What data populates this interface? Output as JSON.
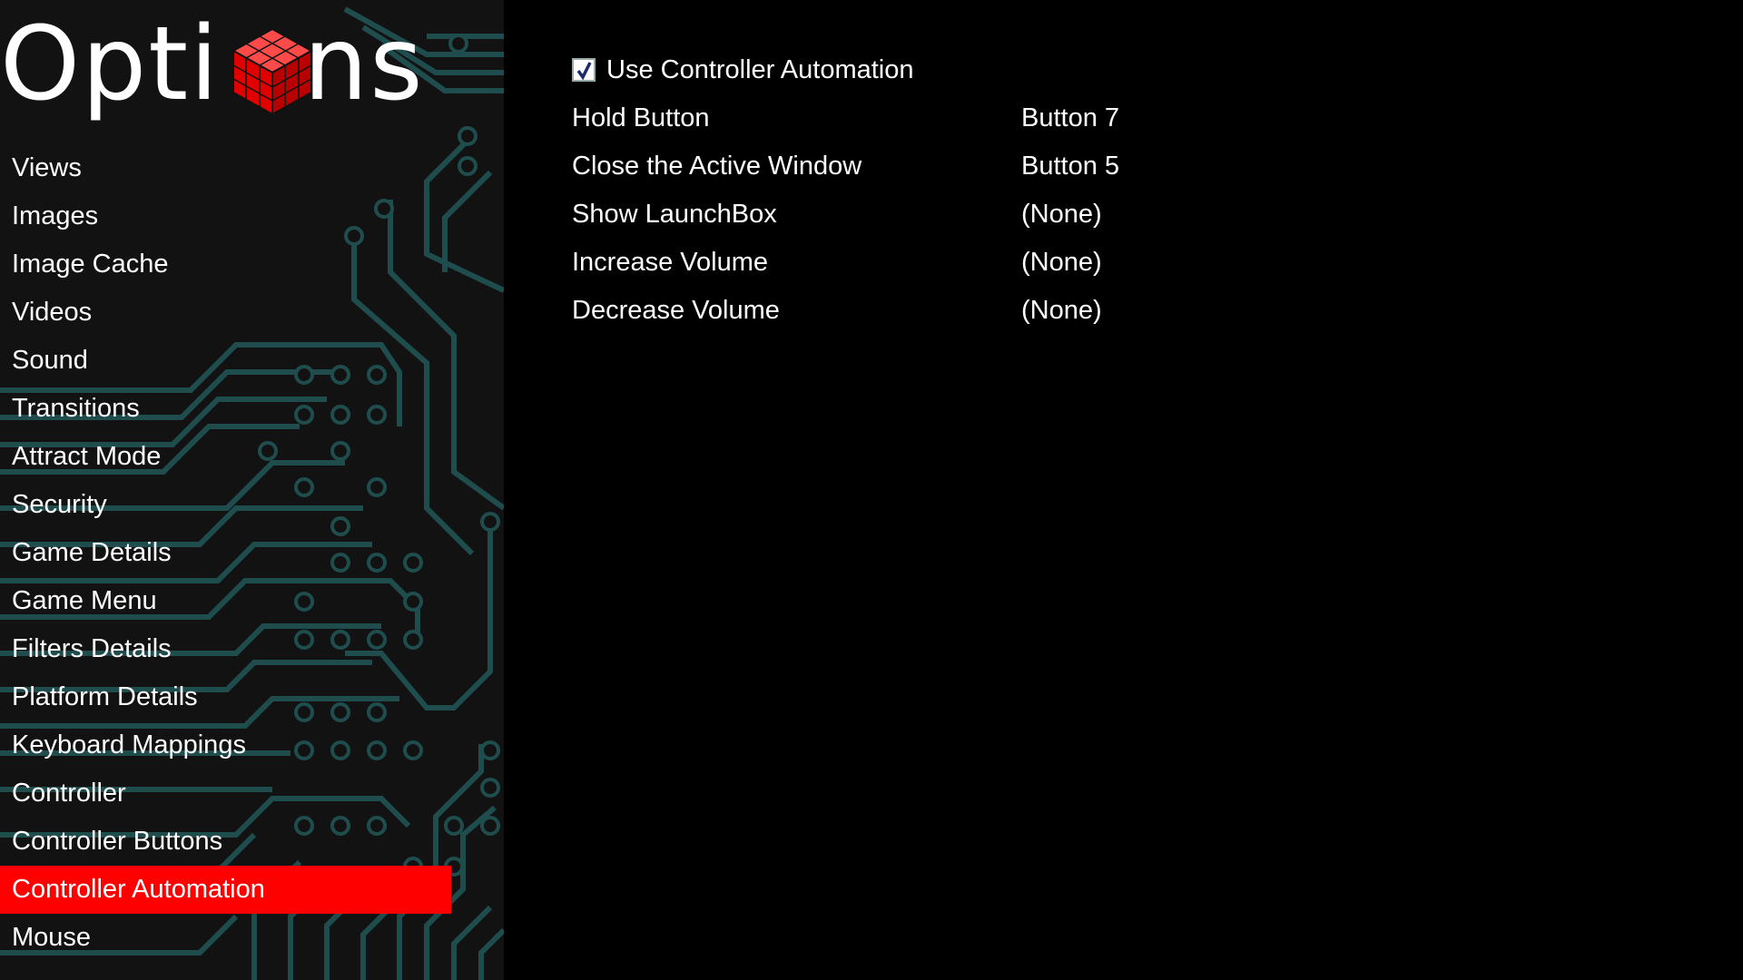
{
  "header": {
    "title_part1": "Opti",
    "title_part2": "ns",
    "logo_icon": "cube-icon"
  },
  "sidebar": {
    "items": [
      {
        "label": "Views",
        "active": false
      },
      {
        "label": "Images",
        "active": false
      },
      {
        "label": "Image Cache",
        "active": false
      },
      {
        "label": "Videos",
        "active": false
      },
      {
        "label": "Sound",
        "active": false
      },
      {
        "label": "Transitions",
        "active": false
      },
      {
        "label": "Attract Mode",
        "active": false
      },
      {
        "label": "Security",
        "active": false
      },
      {
        "label": "Game Details",
        "active": false
      },
      {
        "label": "Game Menu",
        "active": false
      },
      {
        "label": "Filters Details",
        "active": false
      },
      {
        "label": "Platform Details",
        "active": false
      },
      {
        "label": "Keyboard Mappings",
        "active": false
      },
      {
        "label": "Controller",
        "active": false
      },
      {
        "label": "Controller Buttons",
        "active": false
      },
      {
        "label": "Controller Automation",
        "active": true
      },
      {
        "label": "Mouse",
        "active": false
      }
    ]
  },
  "main": {
    "use_automation": {
      "label": "Use Controller Automation",
      "checked": true
    },
    "settings": [
      {
        "label": "Hold Button",
        "value": "Button 7"
      },
      {
        "label": "Close the Active Window",
        "value": "Button 5"
      },
      {
        "label": "Show LaunchBox",
        "value": "(None)"
      },
      {
        "label": "Increase Volume",
        "value": "(None)"
      },
      {
        "label": "Decrease Volume",
        "value": "(None)"
      }
    ]
  },
  "colors": {
    "accent": "#ff0000",
    "circuit": "#1f4d4d",
    "sidebar_bg": "#121212",
    "background": "#000000"
  }
}
